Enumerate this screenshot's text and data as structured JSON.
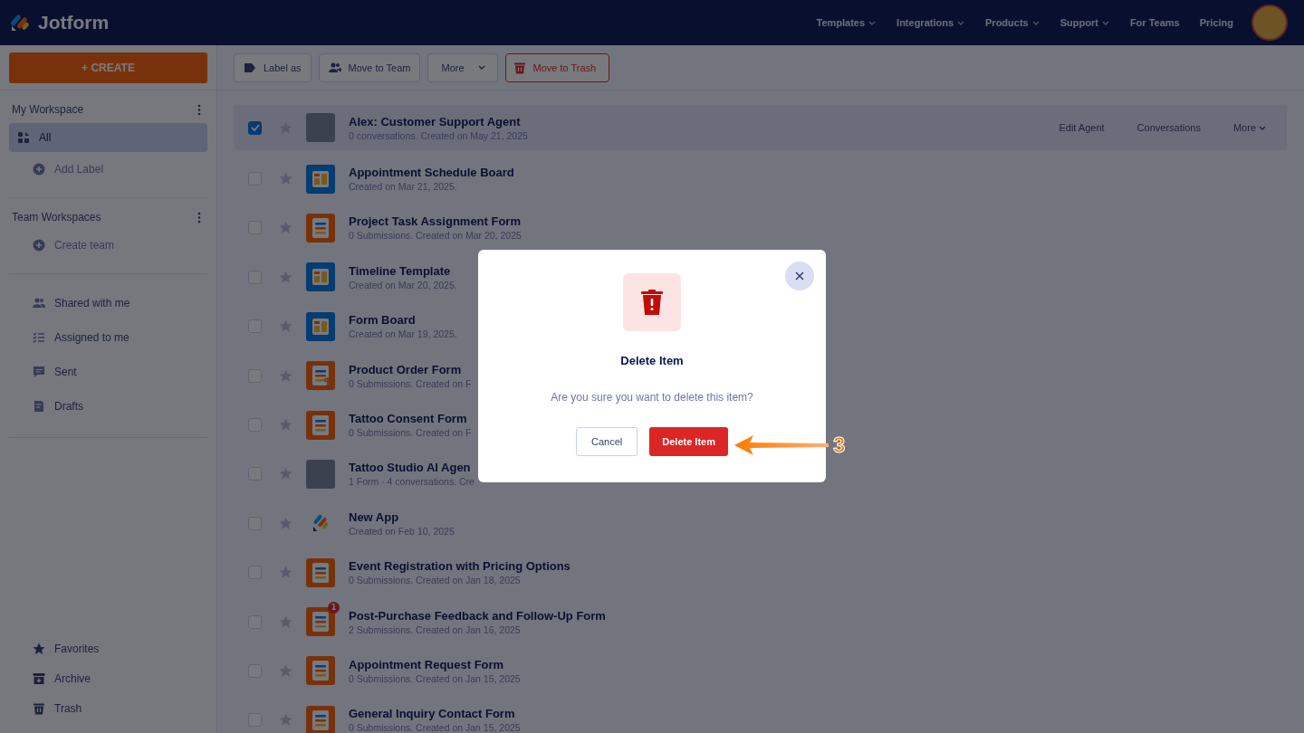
{
  "header": {
    "logo": "Jotform",
    "nav": [
      {
        "label": "Templates",
        "caret": true
      },
      {
        "label": "Integrations",
        "caret": true
      },
      {
        "label": "Products",
        "caret": true
      },
      {
        "label": "Support",
        "caret": true
      },
      {
        "label": "For Teams",
        "caret": false
      },
      {
        "label": "Pricing",
        "caret": false
      }
    ]
  },
  "sidebar": {
    "create": "+ CREATE",
    "sections": [
      {
        "title": "My Workspace",
        "items": [
          {
            "label": "All",
            "kind": "all",
            "selected": true
          },
          {
            "label": "Add Label",
            "kind": "add",
            "selected": false
          }
        ]
      },
      {
        "title": "Team Workspaces",
        "items": [
          {
            "label": "Create team",
            "kind": "add",
            "selected": false
          }
        ]
      },
      {
        "items": [
          {
            "label": "Shared with me",
            "kind": "shared",
            "selected": false
          },
          {
            "label": "Assigned to me",
            "kind": "assigned",
            "selected": false
          },
          {
            "label": "Sent",
            "kind": "sent",
            "selected": false
          },
          {
            "label": "Drafts",
            "kind": "drafts",
            "selected": false
          }
        ]
      }
    ],
    "bottom_items": [
      {
        "label": "Favorites",
        "kind": "favorites",
        "selected": false
      },
      {
        "label": "Archive",
        "kind": "archive",
        "selected": false
      },
      {
        "label": "Trash",
        "kind": "trash",
        "selected": false
      }
    ]
  },
  "toolbar": [
    {
      "label": "Label as",
      "kind": "label"
    },
    {
      "label": "Move to Team",
      "kind": "team"
    },
    {
      "label": "More",
      "kind": "more"
    },
    {
      "label": "Move to Trash",
      "kind": "trash"
    }
  ],
  "rows": [
    {
      "title": "Alex: Customer Support Agent",
      "subtitle": "0 conversations. Created on May 21, 2025",
      "kind": "agent",
      "checked": true,
      "starred": false,
      "actions": [
        "Edit Agent",
        "Conversations",
        "More"
      ]
    },
    {
      "title": "Appointment Schedule Board",
      "subtitle": "Created on Mar 21, 2025.",
      "kind": "board",
      "checked": false,
      "starred": false
    },
    {
      "title": "Project Task Assignment Form",
      "subtitle": "0 Submissions. Created on Mar 20, 2025",
      "kind": "form",
      "checked": false,
      "starred": false
    },
    {
      "title": "Timeline Template",
      "subtitle": "Created on Mar 20, 2025.",
      "kind": "board",
      "checked": false,
      "starred": false
    },
    {
      "title": "Form Board",
      "subtitle": "Created on Mar 19, 2025.",
      "kind": "board",
      "checked": false,
      "starred": false
    },
    {
      "title": "Product Order Form",
      "subtitle": "0 Submissions. Created on F",
      "kind": "payment",
      "checked": false,
      "starred": false
    },
    {
      "title": "Tattoo Consent Form",
      "subtitle": "0 Submissions. Created on F",
      "kind": "form",
      "checked": false,
      "starred": false
    },
    {
      "title": "Tattoo Studio AI Agen",
      "subtitle": "1 Form · 4 conversations. Cre",
      "kind": "agent",
      "checked": false,
      "starred": false
    },
    {
      "title": "New App",
      "subtitle": "Created on Feb 10, 2025",
      "kind": "app",
      "checked": false,
      "starred": false
    },
    {
      "title": "Event Registration with Pricing Options",
      "subtitle": "0 Submissions. Created on Jan 18, 2025",
      "kind": "form",
      "checked": false,
      "starred": false
    },
    {
      "title": "Post-Purchase Feedback and Follow-Up Form",
      "subtitle": "2 Submissions. Created on Jan 16, 2025",
      "kind": "form",
      "checked": false,
      "starred": false,
      "badge": "1"
    },
    {
      "title": "Appointment Request Form",
      "subtitle": "0 Submissions. Created on Jan 15, 2025",
      "kind": "form",
      "checked": false,
      "starred": false
    },
    {
      "title": "General Inquiry Contact Form",
      "subtitle": "0 Submissions. Created on Jan 15, 2025",
      "kind": "form",
      "checked": false,
      "starred": false
    }
  ],
  "dialog": {
    "title": "Delete Item",
    "message": "Are you sure you want to delete this item?",
    "cancel": "Cancel",
    "confirm": "Delete Item"
  },
  "annotation": {
    "step": "3"
  }
}
